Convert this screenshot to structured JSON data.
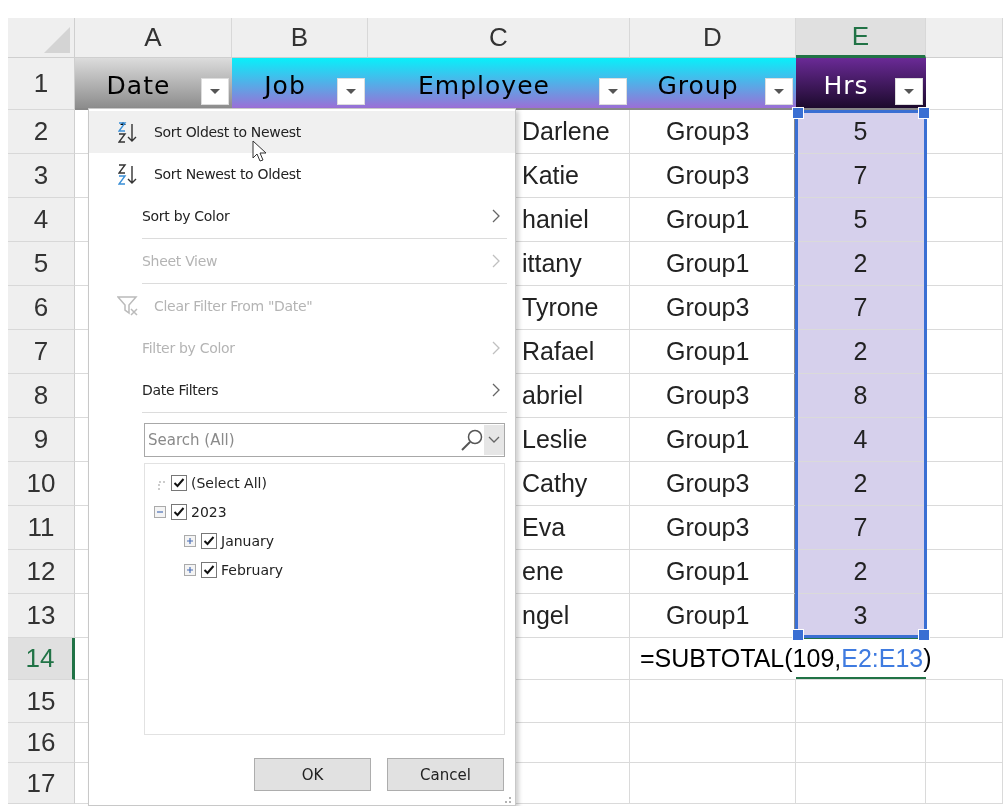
{
  "columns": [
    {
      "letter": "A",
      "selected": false
    },
    {
      "letter": "B",
      "selected": false
    },
    {
      "letter": "C",
      "selected": false
    },
    {
      "letter": "D",
      "selected": false
    },
    {
      "letter": "E",
      "selected": true
    }
  ],
  "row_numbers": [
    {
      "label": "1",
      "selected": false
    },
    {
      "label": "2",
      "selected": false
    },
    {
      "label": "3",
      "selected": false
    },
    {
      "label": "4",
      "selected": false
    },
    {
      "label": "5",
      "selected": false
    },
    {
      "label": "6",
      "selected": false
    },
    {
      "label": "7",
      "selected": false
    },
    {
      "label": "8",
      "selected": false
    },
    {
      "label": "9",
      "selected": false
    },
    {
      "label": "10",
      "selected": false
    },
    {
      "label": "11",
      "selected": false
    },
    {
      "label": "12",
      "selected": false
    },
    {
      "label": "13",
      "selected": false
    },
    {
      "label": "14",
      "selected": true
    },
    {
      "label": "15",
      "selected": false
    },
    {
      "label": "16",
      "selected": false
    },
    {
      "label": "17",
      "selected": false
    }
  ],
  "table": {
    "headers": [
      {
        "label": "Date",
        "kind": "gray"
      },
      {
        "label": "Job",
        "kind": "cyan"
      },
      {
        "label": "Employee",
        "kind": "cyan"
      },
      {
        "label": "Group",
        "kind": "cyan"
      },
      {
        "label": "Hrs",
        "kind": "dark"
      }
    ],
    "rows": [
      {
        "employee": "Darlene",
        "group": "Group3",
        "hrs": "5"
      },
      {
        "employee": "Katie",
        "group": "Group3",
        "hrs": "7"
      },
      {
        "employee": "haniel",
        "group": "Group1",
        "hrs": "5"
      },
      {
        "employee": "ittany",
        "group": "Group1",
        "hrs": "2"
      },
      {
        "employee": "Tyrone",
        "group": "Group3",
        "hrs": "7"
      },
      {
        "employee": "Rafael",
        "group": "Group1",
        "hrs": "2"
      },
      {
        "employee": "abriel",
        "group": "Group3",
        "hrs": "8"
      },
      {
        "employee": "Leslie",
        "group": "Group1",
        "hrs": "4"
      },
      {
        "employee": "Cathy",
        "group": "Group3",
        "hrs": "2"
      },
      {
        "employee": "Eva",
        "group": "Group3",
        "hrs": "7"
      },
      {
        "employee": "ene",
        "group": "Group1",
        "hrs": "2"
      },
      {
        "employee": "ngel",
        "group": "Group1",
        "hrs": "3"
      }
    ]
  },
  "formula": [
    {
      "text": "=SUBTOTAL(109,",
      "kind": "plain"
    },
    {
      "text": "E2:E13",
      "kind": "ref"
    },
    {
      "text": ")",
      "kind": "plain"
    }
  ],
  "filter_menu": {
    "items": [
      {
        "kind": "sort-asc",
        "label": "Sort Oldest to Newest",
        "disabled": false,
        "highlighted": true,
        "submenu": false
      },
      {
        "kind": "sort-desc",
        "label": "Sort Newest to Oldest",
        "disabled": false,
        "highlighted": false,
        "submenu": false
      },
      {
        "kind": "plain",
        "label": "Sort by Color",
        "disabled": false,
        "highlighted": false,
        "submenu": true
      },
      {
        "kind": "separator"
      },
      {
        "kind": "plain",
        "label": "Sheet View",
        "disabled": true,
        "highlighted": false,
        "submenu": true
      },
      {
        "kind": "separator"
      },
      {
        "kind": "clear-filter",
        "label": "Clear Filter From \"Date\"",
        "disabled": true,
        "highlighted": false,
        "submenu": false
      },
      {
        "kind": "plain",
        "label": "Filter by Color",
        "disabled": true,
        "highlighted": false,
        "submenu": true
      },
      {
        "kind": "plain",
        "label": "Date Filters",
        "disabled": false,
        "highlighted": false,
        "submenu": true
      },
      {
        "kind": "separator"
      }
    ],
    "search": {
      "placeholder": "Search (All)"
    },
    "tree": [
      {
        "label": "(Select All)",
        "checked": true
      },
      {
        "label": "2023",
        "checked": true,
        "expanded": true,
        "children": [
          {
            "label": "January",
            "checked": true,
            "expanded": false
          },
          {
            "label": "February",
            "checked": true,
            "expanded": false
          }
        ]
      }
    ],
    "buttons": [
      "OK",
      "Cancel"
    ]
  }
}
